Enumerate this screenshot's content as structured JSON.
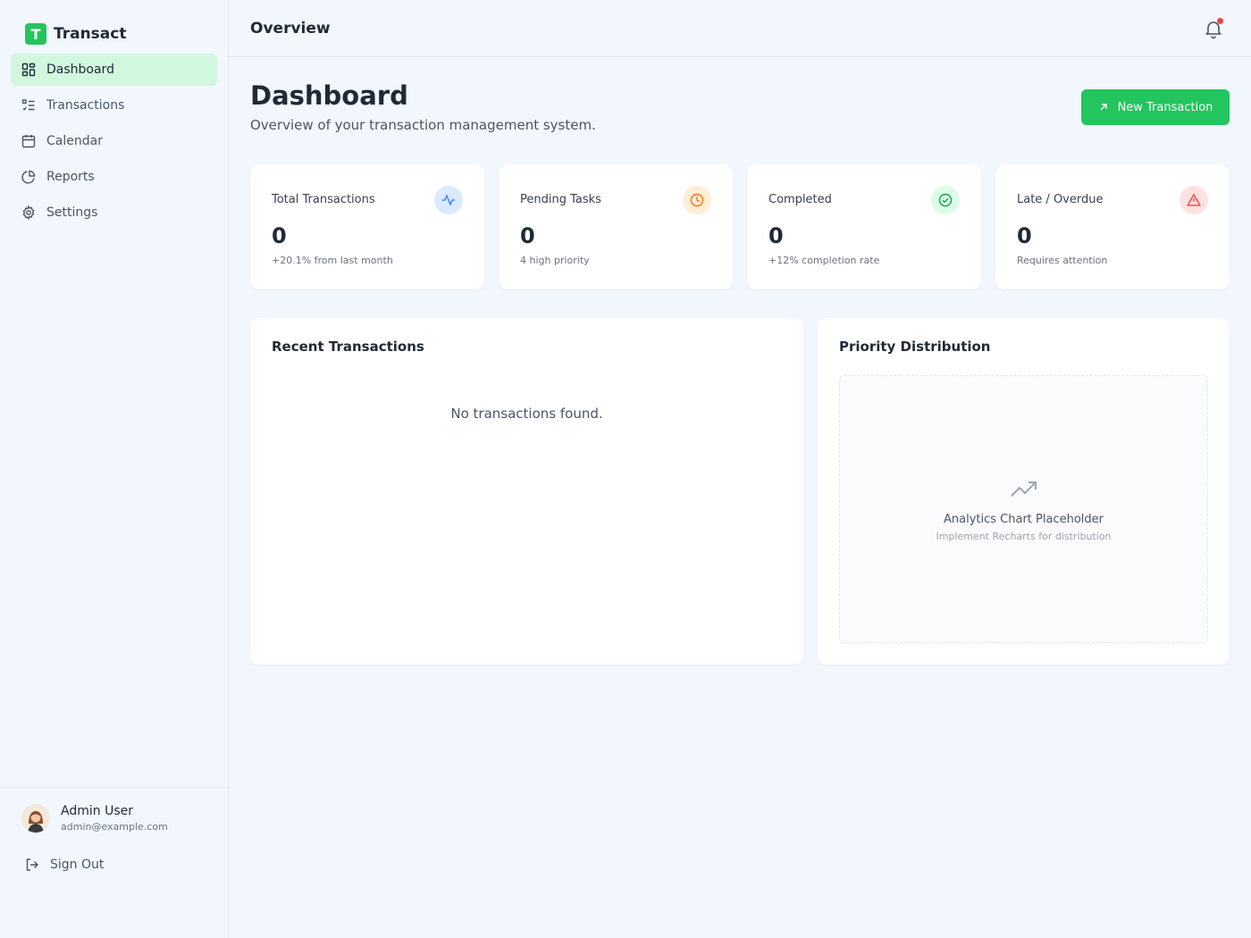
{
  "brand": {
    "logo_letter": "T",
    "name": "Transact",
    "accent": "#22c55e"
  },
  "sidebar": {
    "items": [
      {
        "label": "Dashboard",
        "icon": "dashboard-grid-icon",
        "active": true
      },
      {
        "label": "Transactions",
        "icon": "list-checks-icon"
      },
      {
        "label": "Calendar",
        "icon": "calendar-icon"
      },
      {
        "label": "Reports",
        "icon": "pie-chart-icon"
      },
      {
        "label": "Settings",
        "icon": "gear-icon"
      }
    ],
    "user": {
      "name": "Admin User",
      "email": "admin@example.com"
    },
    "signout_label": "Sign Out"
  },
  "header": {
    "title": "Overview",
    "notification_icon": "bell-icon",
    "notification_color": "#ef4444"
  },
  "main": {
    "title": "Dashboard",
    "subtitle": "Overview of your transaction management system.",
    "new_button_label": "New Transaction",
    "stats": [
      {
        "label": "Total Transactions",
        "value": "0",
        "sub": "+20.1% from last month",
        "icon": "activity-icon",
        "color": "#3b82f6"
      },
      {
        "label": "Pending Tasks",
        "value": "0",
        "sub": "4 high priority",
        "icon": "clock-icon",
        "color": "#f97316"
      },
      {
        "label": "Completed",
        "value": "0",
        "sub": "+12% completion rate",
        "icon": "check-circle-icon",
        "color": "#16a34a"
      },
      {
        "label": "Late / Overdue",
        "value": "0",
        "sub": "Requires attention",
        "icon": "alert-triangle-icon",
        "color": "#ef4444"
      }
    ],
    "recent": {
      "title": "Recent Transactions",
      "empty": "No transactions found."
    },
    "priority": {
      "title": "Priority Distribution",
      "placeholder_title": "Analytics Chart Placeholder",
      "placeholder_sub": "Implement Recharts for distribution"
    }
  }
}
